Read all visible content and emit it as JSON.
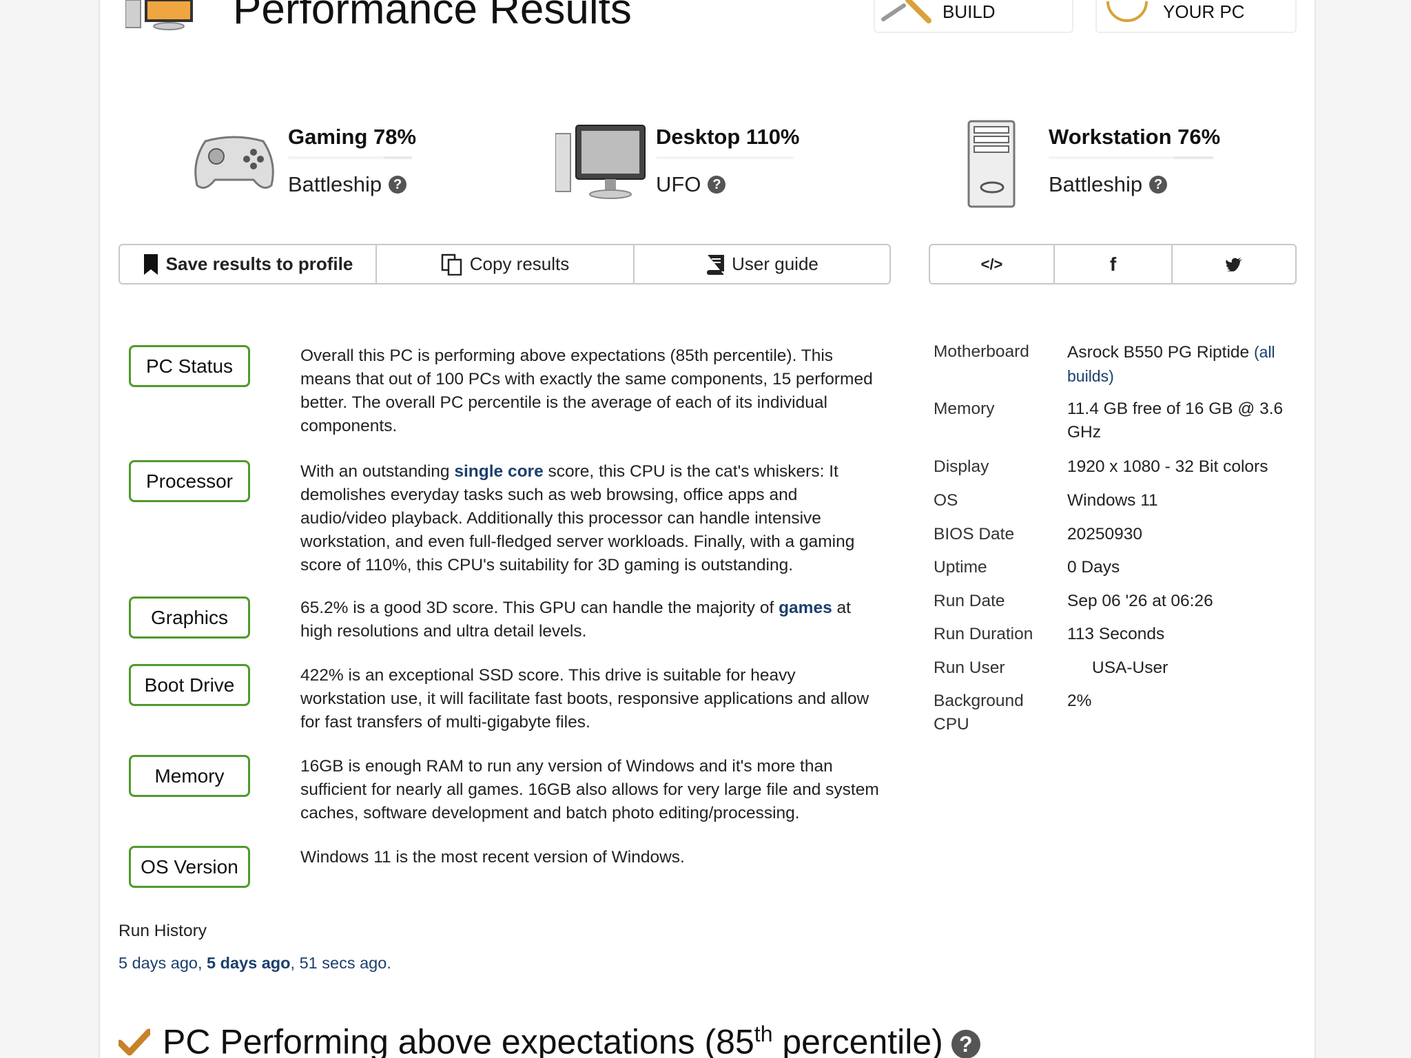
{
  "header": {
    "title": "Performance Results",
    "nav": [
      {
        "label": "BUILD",
        "icon": "tools-icon"
      },
      {
        "label": "YOUR PC",
        "icon": "gauge-icon"
      }
    ]
  },
  "scores": [
    {
      "title": "Gaming 78%",
      "label": "Battleship",
      "percent": 78,
      "icon": "gamepad-icon"
    },
    {
      "title": "Desktop 110%",
      "label": "UFO",
      "percent": 110,
      "icon": "desktop-icon"
    },
    {
      "title": "Workstation 76%",
      "label": "Battleship",
      "percent": 76,
      "icon": "tower-icon"
    }
  ],
  "help_glyph": "?",
  "toolbar": {
    "save": "Save results to profile",
    "copy": "Copy results",
    "guide": "User guide",
    "embed_glyph": "</>",
    "facebook_glyph": "f",
    "twitter_glyph": "t"
  },
  "status": {
    "pc": {
      "label": "PC Status",
      "text": "Overall this PC is performing above expectations (85th percentile). This means that out of 100 PCs with exactly the same components, 15 performed better. The overall PC percentile is the average of each of its individual components."
    },
    "processor": {
      "label": "Processor",
      "pre": "With an outstanding ",
      "link": "single core",
      "post": " score, this CPU is the cat's whiskers: It demolishes everyday tasks such as web browsing, office apps and audio/video playback. Additionally this processor can handle intensive workstation, and even full-fledged server workloads. Finally, with a gaming score of 110%, this CPU's suitability for 3D gaming is outstanding."
    },
    "graphics": {
      "label": "Graphics",
      "pre": "65.2% is a good 3D score. This GPU can handle the majority of ",
      "link": "games",
      "post": " at high resolutions and ultra detail levels."
    },
    "boot": {
      "label": "Boot Drive",
      "text": "422% is an exceptional SSD score. This drive is suitable for heavy workstation use, it will facilitate fast boots, responsive applications and allow for fast transfers of multi-gigabyte files."
    },
    "memory": {
      "label": "Memory",
      "text": "16GB is enough RAM to run any version of Windows and it's more than sufficient for nearly all games. 16GB also allows for very large file and system caches, software development and batch photo editing/processing."
    },
    "os": {
      "label": "OS Version",
      "text": "Windows 11 is the most recent version of Windows."
    }
  },
  "specs": {
    "motherboard": {
      "label": "Motherboard",
      "value": "Asrock B550 PG Riptide",
      "link": "(all builds)"
    },
    "memory": {
      "label": "Memory",
      "value": "11.4 GB free of 16 GB @ 3.6 GHz"
    },
    "display": {
      "label": "Display",
      "value": "1920 x 1080 - 32 Bit colors"
    },
    "os": {
      "label": "OS",
      "value": "Windows 11"
    },
    "bios": {
      "label": "BIOS Date",
      "value": "20250930"
    },
    "uptime": {
      "label": "Uptime",
      "value": "0 Days"
    },
    "run_date": {
      "label": "Run Date",
      "value": "Sep 06 '26 at 06:26"
    },
    "run_duration": {
      "label": "Run Duration",
      "value": "113 Seconds"
    },
    "run_user": {
      "label": "Run User",
      "value": "USA-User"
    },
    "background_cpu": {
      "label": "Background CPU",
      "value": "2%"
    }
  },
  "history": {
    "title": "Run History",
    "items": [
      "5 days ago",
      "5 days ago",
      "51 secs ago"
    ],
    "sep": ", ",
    "end": "."
  },
  "bottom": {
    "prefix": "PC Performing above expectations (85",
    "sup": "th",
    "suffix": " percentile)"
  },
  "colors": {
    "status_border": "#4f9a2b",
    "link": "#1c3f6e",
    "check": "#c8822a"
  }
}
